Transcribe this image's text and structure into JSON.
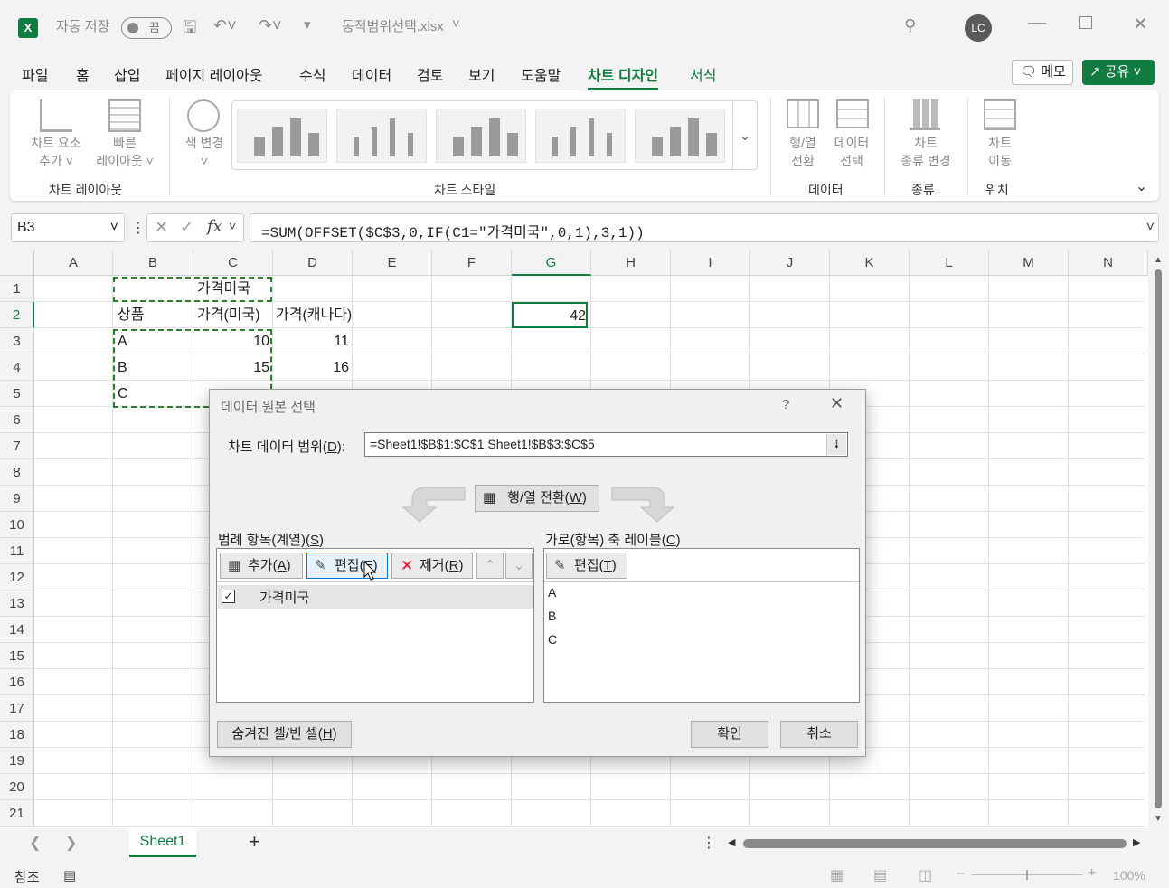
{
  "titlebar": {
    "autosave_label": "자동 저장",
    "autosave_state": "끔",
    "filename": "동적범위선택.xlsx",
    "user_initials": "LC"
  },
  "menu": {
    "tabs": [
      "파일",
      "홈",
      "삽입",
      "페이지 레이아웃",
      "수식",
      "데이터",
      "검토",
      "보기",
      "도움말",
      "차트 디자인",
      "서식"
    ],
    "active_tab": "차트 디자인",
    "memo_label": "메모",
    "share_label": "공유"
  },
  "ribbon": {
    "add_chart_element": [
      "차트 요소",
      "추가"
    ],
    "quick_layout": [
      "빠른",
      "레이아웃"
    ],
    "change_colors": "색 변경",
    "switch_row_col": [
      "행/열",
      "전환"
    ],
    "select_data": [
      "데이터",
      "선택"
    ],
    "change_chart_type": [
      "차트",
      "종류 변경"
    ],
    "move_chart": [
      "차트",
      "이동"
    ],
    "groups": {
      "chart_layout": "차트 레이아웃",
      "chart_styles": "차트 스타일",
      "data": "데이터",
      "type": "종류",
      "location": "위치"
    },
    "style_thumbnails": [
      {
        "bars": [
          0.5,
          0.75,
          0.95,
          0.6
        ]
      },
      {
        "bars": [
          0.5,
          0.75,
          0.95,
          0.6
        ]
      },
      {
        "bars": [
          0.5,
          0.75,
          0.95,
          0.6
        ]
      },
      {
        "bars": [
          0.5,
          0.75,
          0.95,
          0.6
        ]
      },
      {
        "bars": [
          0.5,
          0.75,
          0.95,
          0.6
        ]
      }
    ]
  },
  "formula_bar": {
    "name_box": "B3",
    "formula": "=SUM(OFFSET($C$3,0,IF(C1=\"가격미국\",0,1),3,1))"
  },
  "grid": {
    "columns": [
      "A",
      "B",
      "C",
      "D",
      "E",
      "F",
      "G",
      "H",
      "I",
      "J",
      "K",
      "L",
      "M",
      "N"
    ],
    "rows": [
      "1",
      "2",
      "3",
      "4",
      "5",
      "6",
      "7",
      "8",
      "9",
      "10",
      "11",
      "12",
      "13",
      "14",
      "15",
      "16",
      "17",
      "18",
      "19",
      "20",
      "21"
    ],
    "cells": {
      "C1": "가격미국",
      "B2": "상품",
      "C2": "가격(미국)",
      "D2": "가격(캐나다)",
      "B3": "A",
      "C3": "10",
      "D3": "11",
      "B4": "B",
      "C4": "15",
      "D4": "16",
      "B5": "C",
      "G2": "42"
    }
  },
  "dialog": {
    "title": "데이터 원본 선택",
    "help": "?",
    "range_label": "차트 데이터 범위(",
    "range_key": "D",
    "range_label_end": "):",
    "range_value": "=Sheet1!$B$1:$C$1,Sheet1!$B$3:$C$5",
    "switch_label": "행/열 전환(",
    "switch_key": "W",
    "legend_label": "범례 항목(계열)(",
    "legend_key": "S",
    "axis_label": "가로(항목) 축 레이블(",
    "axis_key": "C",
    "add_label": "추가(",
    "add_key": "A",
    "edit_label": "편집(",
    "edit_key": "E",
    "remove_label": "제거(",
    "remove_key": "R",
    "axis_edit_label": "편집(",
    "axis_edit_key": "T",
    "series": [
      {
        "name": "가격미국",
        "checked": true
      }
    ],
    "axis_items": [
      "A",
      "B",
      "C"
    ],
    "hidden_cells_label": "숨겨진 셀/빈 셀(",
    "hidden_cells_key": "H",
    "ok_label": "확인",
    "cancel_label": "취소"
  },
  "sheets": {
    "tabs": [
      "Sheet1"
    ]
  },
  "status": {
    "mode": "참조",
    "zoom": "100%"
  }
}
